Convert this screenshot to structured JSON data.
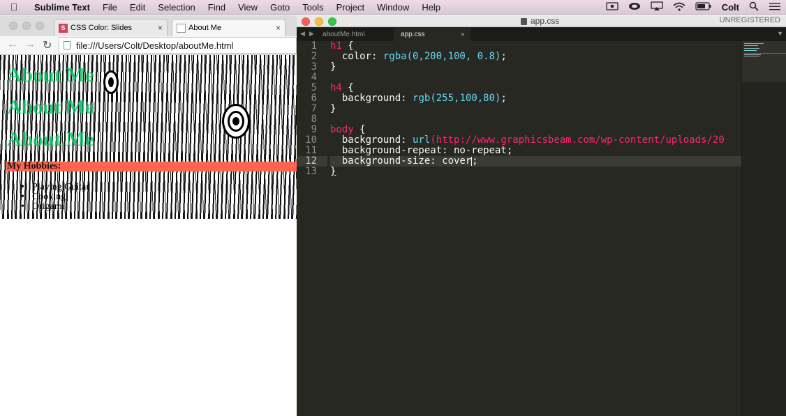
{
  "menubar": {
    "apple_icon": "apple-icon",
    "app_name": "Sublime Text",
    "menus": [
      "File",
      "Edit",
      "Selection",
      "Find",
      "View",
      "Goto",
      "Tools",
      "Project",
      "Window",
      "Help"
    ],
    "status_icons": [
      "screen-record-icon",
      "creative-cloud-icon",
      "airplay-icon",
      "wifi-icon",
      "battery-icon"
    ],
    "user": "Colt",
    "search_icon": "search-icon",
    "list_icon": "notification-list-icon"
  },
  "browser": {
    "tabs": [
      {
        "favicon": "S",
        "title": "CSS Color: Slides",
        "close": "×"
      },
      {
        "favicon": "",
        "title": "About Me",
        "close": "×"
      }
    ],
    "address": "file:///Users/Colt/Desktop/aboutMe.html",
    "page": {
      "headings": [
        "About Me",
        "About Me",
        "About Me"
      ],
      "hobbies_title": "My Hobbies:",
      "hobbies": [
        "Playing Guitar",
        "Cooking",
        "Origami"
      ],
      "colors": {
        "h1": "rgba(0,200,100,0.8)",
        "h4_bg": "#ff6450"
      }
    }
  },
  "sublime": {
    "window_title": "app.css",
    "unregistered": "UNREGISTERED",
    "tabs": [
      {
        "label": "aboutMe.html",
        "active": false
      },
      {
        "label": "app.css",
        "active": true,
        "close": "×"
      }
    ],
    "current_line": 12,
    "line_numbers": [
      "1",
      "2",
      "3",
      "4",
      "5",
      "6",
      "7",
      "8",
      "9",
      "10",
      "11",
      "12",
      "13"
    ],
    "code": {
      "l1_sel": "h1",
      "l1_brace": " {",
      "l2_prop": "  color: ",
      "l2_fn": "rgba",
      "l2_args": "(0,200,100, 0.8)",
      "l2_end": ";",
      "l3": "}",
      "l5_sel": "h4",
      "l5_brace": " {",
      "l6_prop": "  background: ",
      "l6_fn": "rgb",
      "l6_args": "(255,100,80)",
      "l6_end": ";",
      "l7": "}",
      "l9_sel": "body",
      "l9_brace": " {",
      "l10_prop": "  background: ",
      "l10_fn": "url",
      "l10_url": "(http://www.graphicsbeam.com/wp-content/uploads/20",
      "l11": "  background-repeat: no-repeat;",
      "l12_a": "  background-size: cover",
      "l12_b": ";",
      "l13": "}"
    },
    "colors": {
      "bg": "#272822",
      "keyword": "#f92672",
      "function": "#66d9ef",
      "number": "#ae81ff",
      "text": "#f8f8f2"
    }
  }
}
